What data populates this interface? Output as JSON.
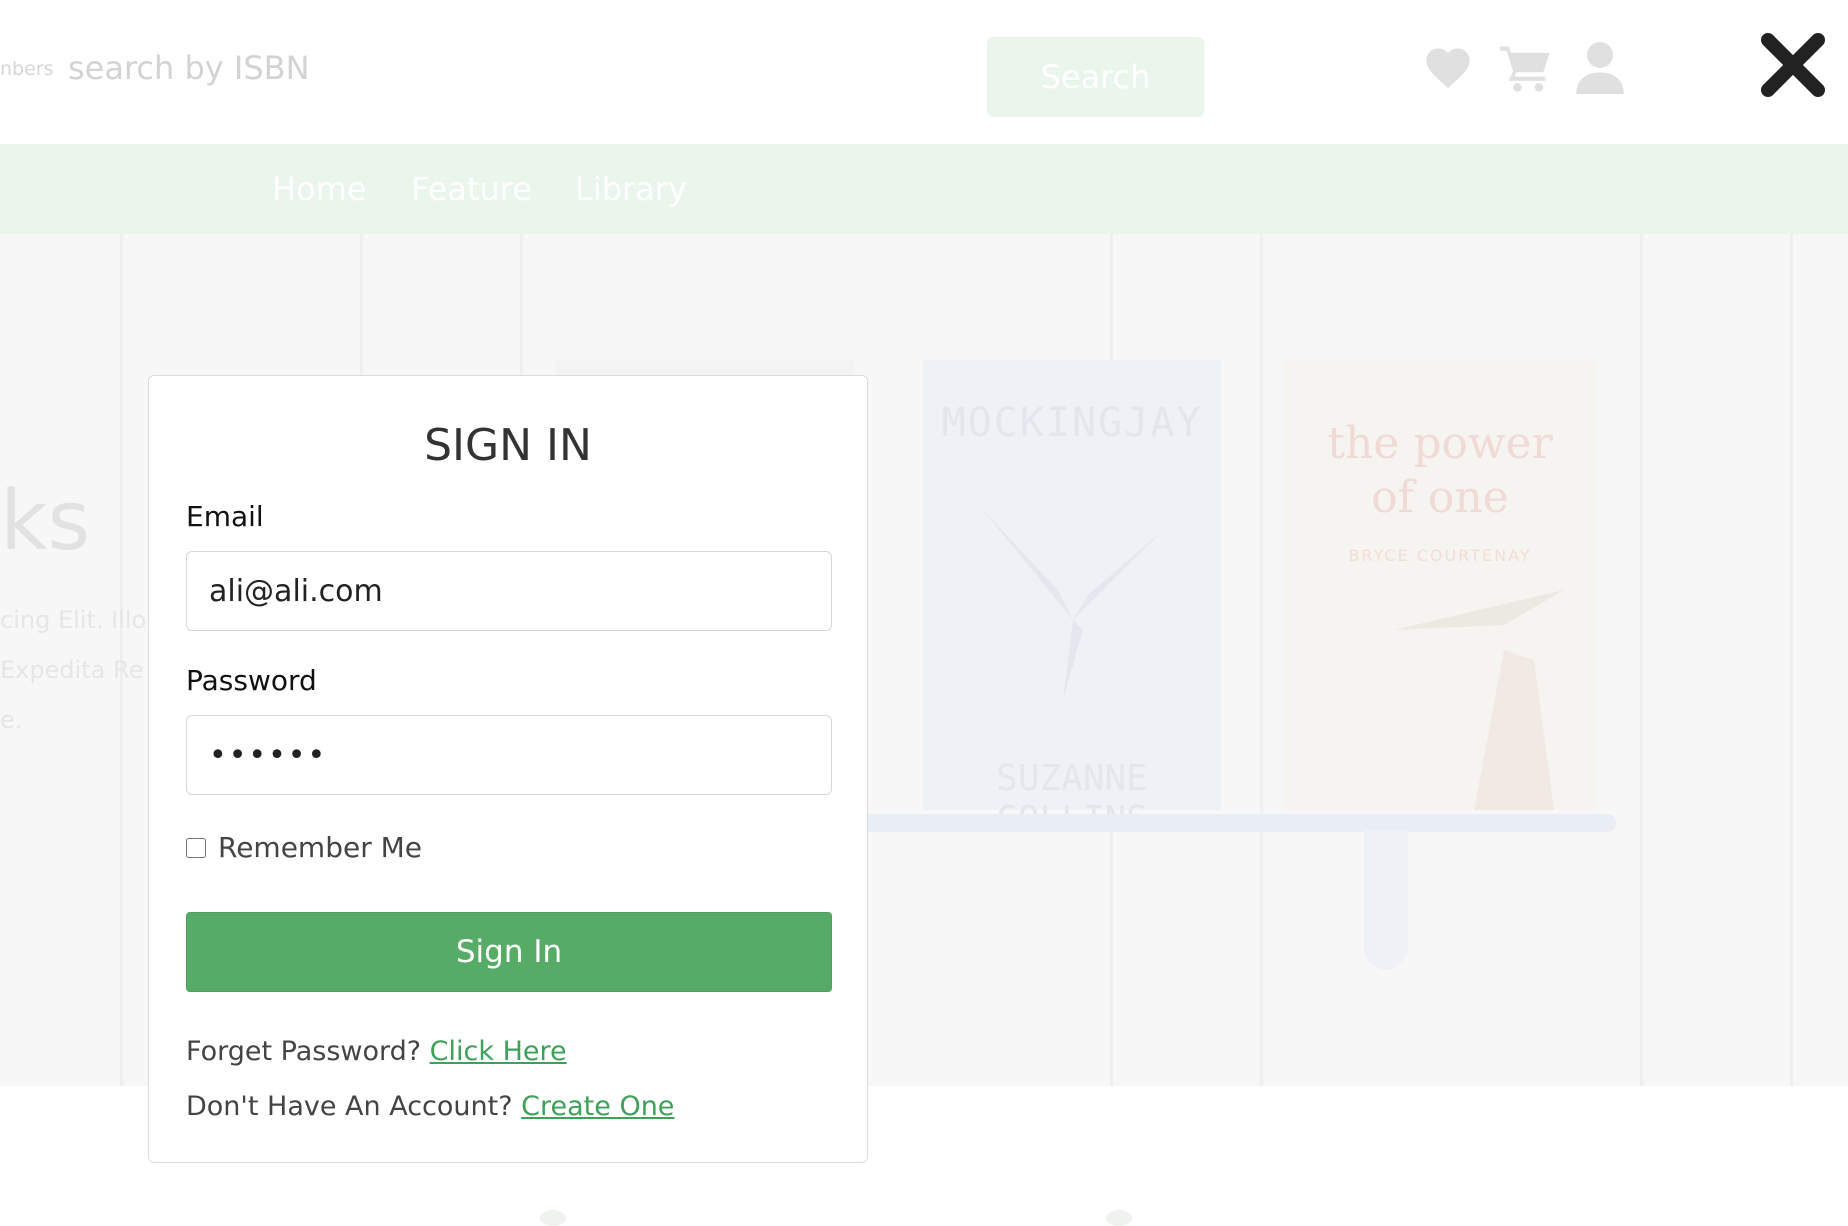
{
  "header": {
    "search_label": "nbers",
    "search_placeholder": "search by ISBN",
    "search_button": "Search"
  },
  "nav": {
    "items": [
      "Home",
      "Feature",
      "Library"
    ]
  },
  "hero": {
    "title_fragment": "ks",
    "lines": [
      "cing Elit. Illo E",
      "Expedita Re",
      "e."
    ]
  },
  "books": [
    {
      "title": "MOCKINGJAY",
      "author": "SUZANNE COLLINS"
    },
    {
      "title_line1": "the power",
      "title_line2": "of one",
      "author": "BRYCE COURTENAY"
    }
  ],
  "modal": {
    "title": "SIGN IN",
    "email_label": "Email",
    "email_value": "ali@ali.com",
    "password_label": "Password",
    "password_value": "••••••",
    "remember_label": "Remember Me",
    "signin_button": "Sign In",
    "forgot_text": "Forget Password?",
    "forgot_link": "Click Here",
    "account_text": "Don't Have An Account?",
    "account_link": "Create One"
  },
  "colors": {
    "primary_green": "#56ac67",
    "link_green": "#3fa05a",
    "nav_bg": "#eaf5ec"
  },
  "icons": [
    "heart-icon",
    "cart-icon",
    "user-icon",
    "close-icon"
  ]
}
